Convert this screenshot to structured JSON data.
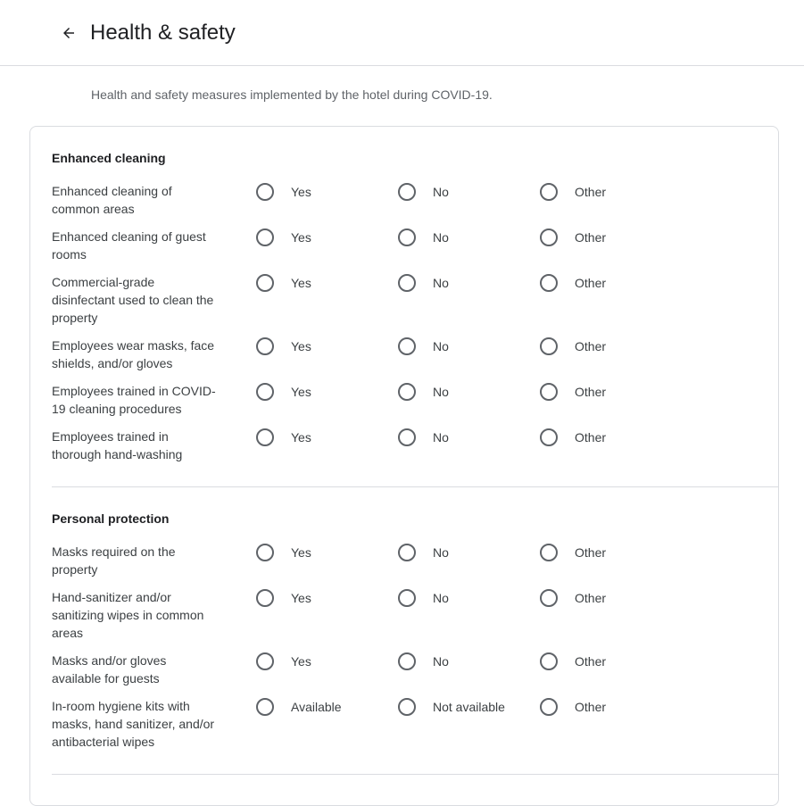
{
  "header": {
    "title": "Health & safety",
    "back_icon": "arrow-left-icon"
  },
  "description": "Health and safety measures implemented by the hotel during COVID-19.",
  "sections": [
    {
      "title": "Enhanced cleaning",
      "items": [
        {
          "label": "Enhanced cleaning of common areas",
          "lines": [
            "Enhanced cleaning of",
            "common areas"
          ],
          "options": [
            "Yes",
            "No",
            "Other"
          ]
        },
        {
          "label": "Enhanced cleaning of guest rooms",
          "lines": [
            "Enhanced cleaning of guest",
            "rooms"
          ],
          "options": [
            "Yes",
            "No",
            "Other"
          ]
        },
        {
          "label": "Commercial-grade disinfectant used to clean the property",
          "lines": [
            "Commercial-grade",
            "disinfectant used to clean the",
            "property"
          ],
          "options": [
            "Yes",
            "No",
            "Other"
          ]
        },
        {
          "label": "Employees wear masks, face shields, and/or gloves",
          "lines": [
            "Employees wear masks, face",
            "shields, and/or gloves"
          ],
          "options": [
            "Yes",
            "No",
            "Other"
          ]
        },
        {
          "label": "Employees trained in COVID-19 cleaning procedures",
          "lines": [
            "Employees trained in COVID-",
            "19 cleaning procedures"
          ],
          "options": [
            "Yes",
            "No",
            "Other"
          ]
        },
        {
          "label": "Employees trained in thorough hand-washing",
          "lines": [
            "Employees trained in",
            "thorough hand-washing"
          ],
          "options": [
            "Yes",
            "No",
            "Other"
          ]
        }
      ]
    },
    {
      "title": "Personal protection",
      "items": [
        {
          "label": "Masks required on the property",
          "lines": [
            "Masks required on the",
            "property"
          ],
          "options": [
            "Yes",
            "No",
            "Other"
          ]
        },
        {
          "label": "Hand-sanitizer and/or sanitizing wipes in common areas",
          "lines": [
            "Hand-sanitizer and/or",
            "sanitizing wipes in common",
            "areas"
          ],
          "options": [
            "Yes",
            "No",
            "Other"
          ]
        },
        {
          "label": "Masks and/or gloves available for guests",
          "lines": [
            "Masks and/or gloves",
            "available for guests"
          ],
          "options": [
            "Yes",
            "No",
            "Other"
          ]
        },
        {
          "label": "In-room hygiene kits with masks, hand sanitizer, and/or antibacterial wipes",
          "lines": [
            "In-room hygiene kits with",
            "masks, hand sanitizer, and/or",
            "antibacterial wipes"
          ],
          "options": [
            "Available",
            "Not available",
            "Other"
          ]
        }
      ]
    }
  ]
}
